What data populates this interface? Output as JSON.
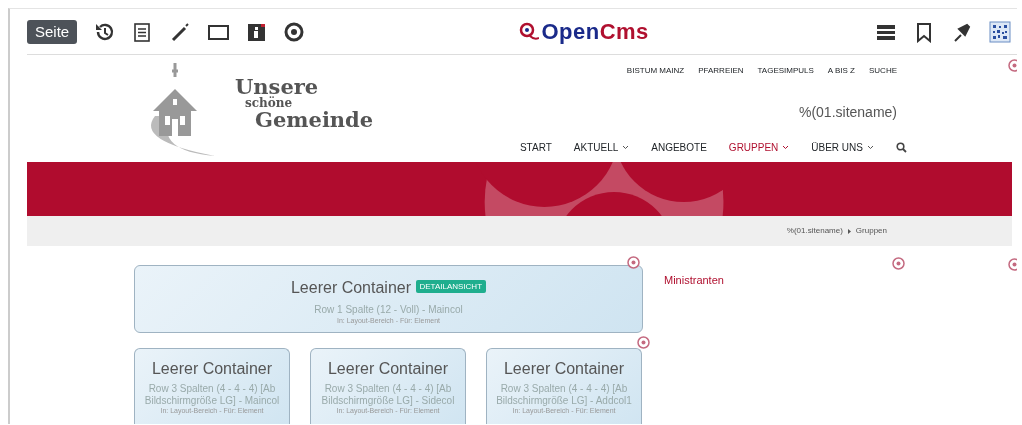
{
  "toolbar": {
    "page_button": "Seite",
    "brand": {
      "mark": "O",
      "word_1": "pen",
      "word_2": "Cms"
    }
  },
  "site": {
    "logo_lines": [
      "Unsere",
      "schöne",
      "Gemeinde"
    ],
    "meta_links": [
      "BISTUM MAINZ",
      "PFARREIEN",
      "TAGESIMPULS",
      "A BIS Z",
      "SUCHE"
    ],
    "sitename": "%(01.sitename)",
    "nav": [
      {
        "label": "START",
        "selected": false,
        "dropdown": false
      },
      {
        "label": "AKTUELL",
        "selected": false,
        "dropdown": true
      },
      {
        "label": "ANGEBOTE",
        "selected": false,
        "dropdown": false
      },
      {
        "label": "GRUPPEN",
        "selected": true,
        "dropdown": true
      },
      {
        "label": "ÜBER UNS",
        "selected": false,
        "dropdown": true
      }
    ]
  },
  "breadcrumb": [
    "%(01.sitename)",
    "Gruppen"
  ],
  "main_container": {
    "title": "Leerer Container",
    "badge": "DETAILANSICHT",
    "description": "Row 1 Spalte (12 - Voll) - Maincol",
    "note": "In: Layout-Bereich - Für: Element"
  },
  "column_containers": [
    {
      "title": "Leerer Container",
      "description": "Row 3 Spalten (4 - 4 - 4) [Ab Bildschirmgröße LG] - Maincol",
      "note": "In: Layout-Bereich - Für: Element"
    },
    {
      "title": "Leerer Container",
      "description": "Row 3 Spalten (4 - 4 - 4) [Ab Bildschirmgröße LG] - Sidecol",
      "note": "In: Layout-Bereich - Für: Element"
    },
    {
      "title": "Leerer Container",
      "description": "Row 3 Spalten (4 - 4 - 4) [Ab Bildschirmgröße LG] - Addcol1",
      "note": "In: Layout-Bereich - Für: Element"
    }
  ],
  "sidebar": {
    "link": "Ministranten"
  }
}
